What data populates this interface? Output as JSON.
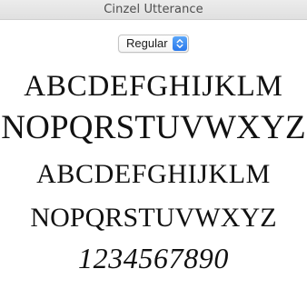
{
  "window": {
    "title": "Cinzel Utterance"
  },
  "toolbar": {
    "style_select": {
      "value": "Regular",
      "icon": "updown-chevron-icon",
      "accent": "#2f80ed"
    }
  },
  "specimen": {
    "lines": [
      "ABCDEFGHIJKLM",
      "NOPQRSTUVWXYZ",
      "ABCDEFGHIJKLM",
      "NOPQRSTUVWXYZ",
      "1234567890"
    ]
  }
}
